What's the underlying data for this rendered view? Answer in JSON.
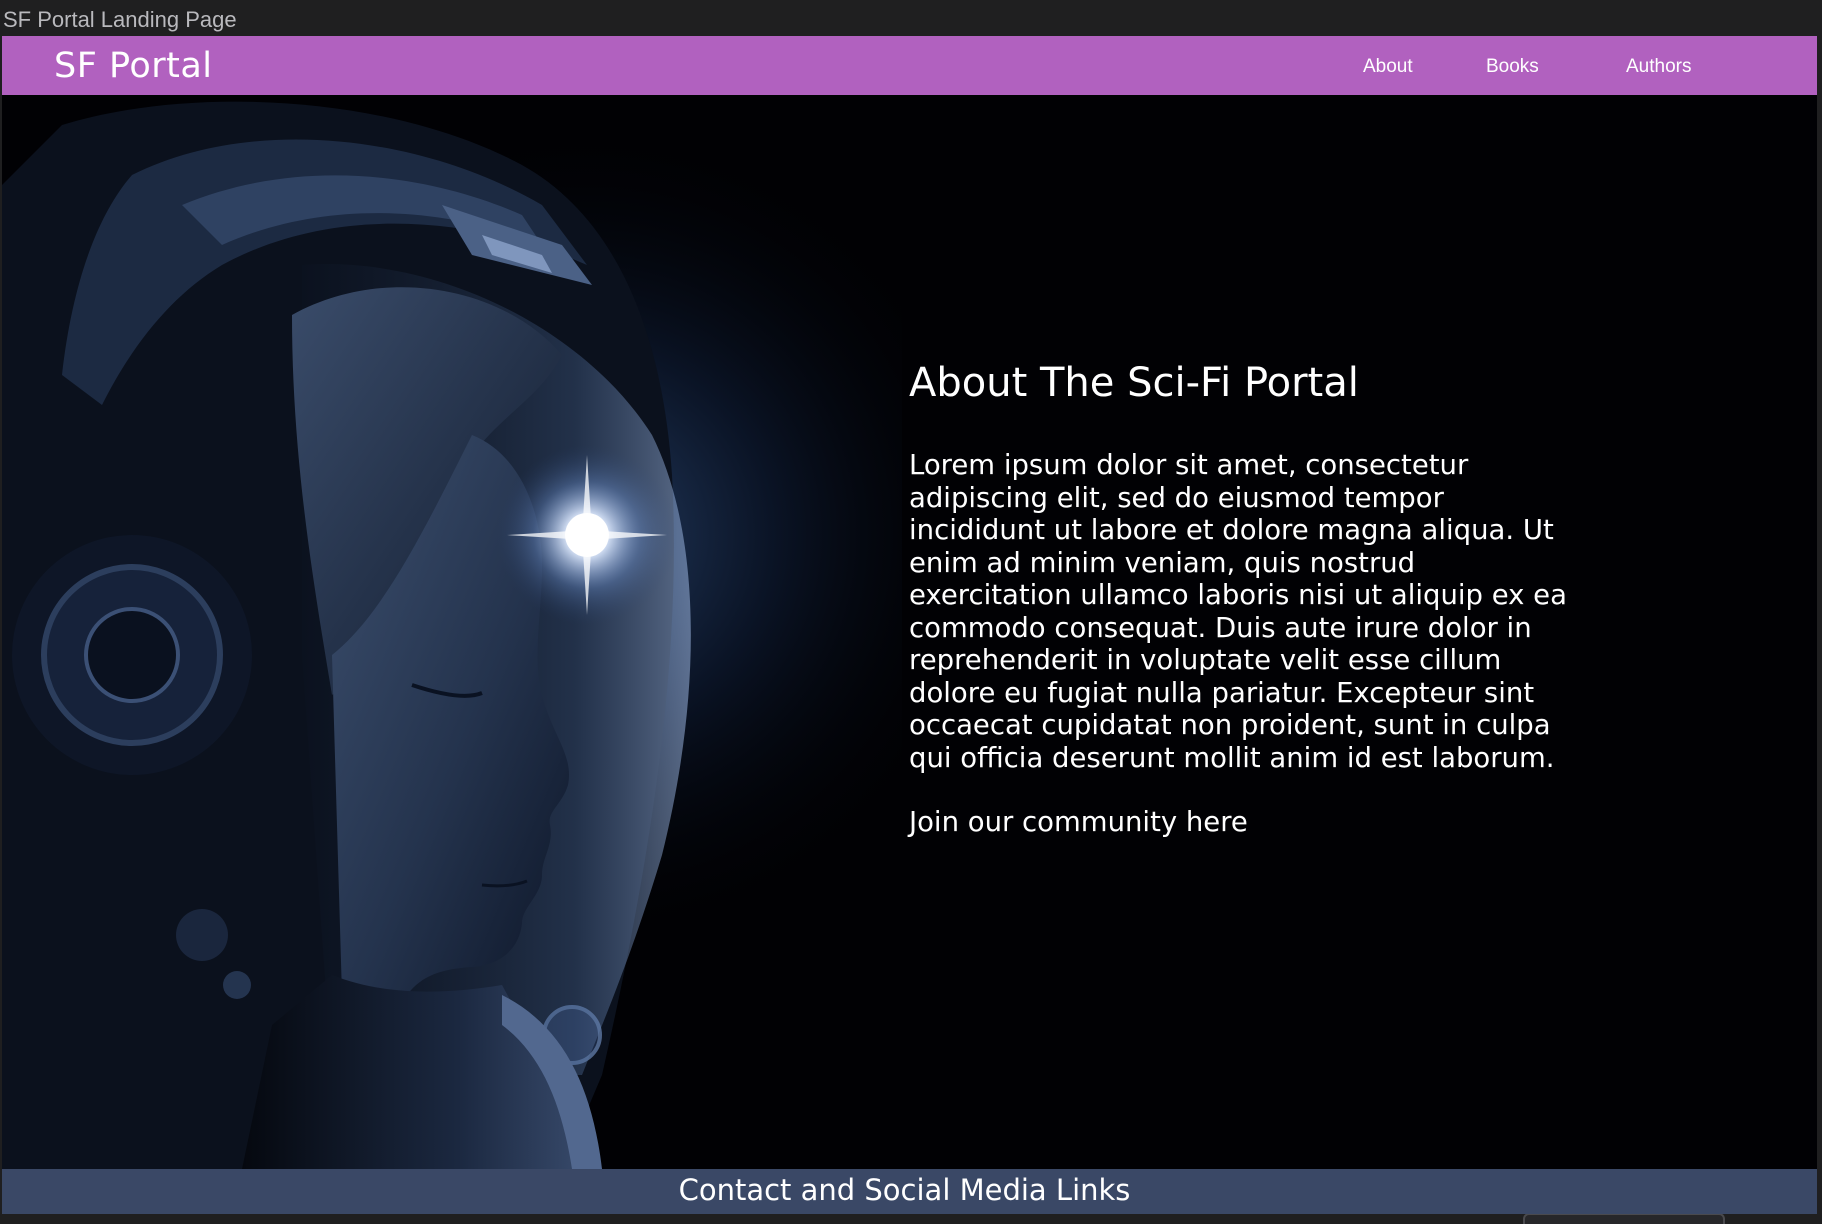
{
  "window": {
    "title": "SF Portal Landing Page"
  },
  "navbar": {
    "brand": "SF Portal",
    "links": [
      {
        "label": "About"
      },
      {
        "label": "Books"
      },
      {
        "label": "Authors"
      }
    ],
    "background_color": "#b161bf"
  },
  "hero": {
    "image": "astronaut-portrait",
    "heading": "About The Sci-Fi Portal",
    "body": "Lorem ipsum dolor sit amet, consectetur adipiscing elit, sed do eiusmod tempor incididunt ut labore et dolore magna aliqua. Ut enim ad minim veniam, quis nostrud exercitation ullamco laboris nisi ut aliquip ex ea commodo consequat. Duis aute irure dolor in reprehenderit in voluptate velit esse cillum dolore eu fugiat nulla pariatur. Excepteur sint occaecat cupidatat non proident, sunt in culpa qui officia deserunt mollit anim id est laborum.",
    "cta": "Join our community here"
  },
  "footer": {
    "label": "Contact and Social Media Links",
    "background_color": "#3a4866"
  }
}
